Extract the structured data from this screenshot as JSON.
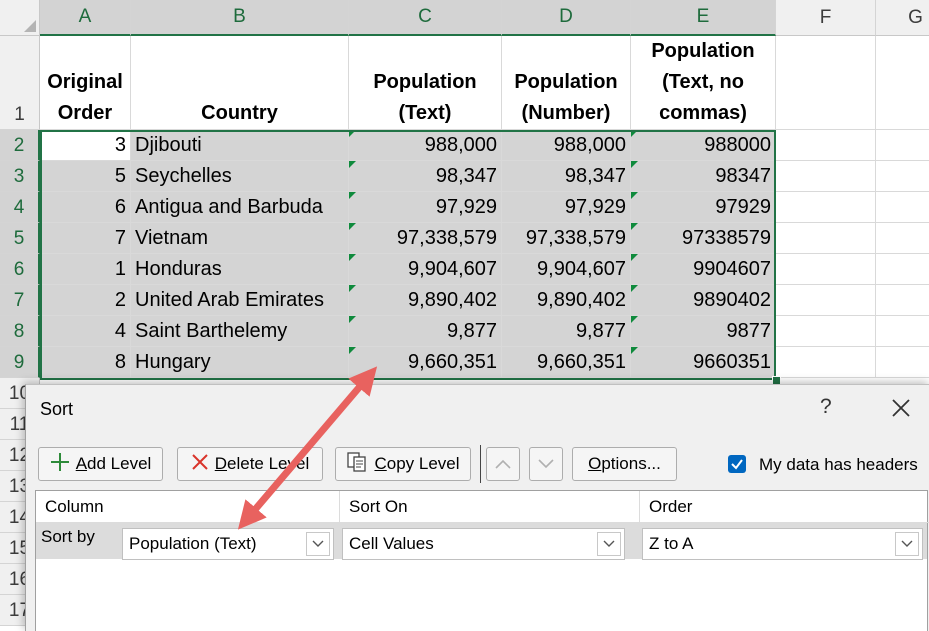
{
  "columns": [
    {
      "label": "A",
      "selected": true
    },
    {
      "label": "B",
      "selected": true
    },
    {
      "label": "C",
      "selected": true
    },
    {
      "label": "D",
      "selected": true
    },
    {
      "label": "E",
      "selected": true
    },
    {
      "label": "F",
      "selected": false
    },
    {
      "label": "G",
      "selected": false
    }
  ],
  "row_numbers": [
    "1",
    "2",
    "3",
    "4",
    "5",
    "6",
    "7",
    "8",
    "9",
    "10",
    "11",
    "12",
    "13",
    "14",
    "15",
    "16",
    "17"
  ],
  "headers": {
    "a": "Original\nOrder",
    "b": "Country",
    "c": "Population\n(Text)",
    "d": "Population\n(Number)",
    "e": "Population\n(Text, no\ncommas)"
  },
  "rows": [
    {
      "order": "3",
      "country": "Djibouti",
      "pop_text": "988,000",
      "pop_num": "988,000",
      "pop_nocomma": "988000"
    },
    {
      "order": "5",
      "country": "Seychelles",
      "pop_text": "98,347",
      "pop_num": "98,347",
      "pop_nocomma": "98347"
    },
    {
      "order": "6",
      "country": "Antigua and Barbuda",
      "pop_text": "97,929",
      "pop_num": "97,929",
      "pop_nocomma": "97929"
    },
    {
      "order": "7",
      "country": "Vietnam",
      "pop_text": "97,338,579",
      "pop_num": "97,338,579",
      "pop_nocomma": "97338579"
    },
    {
      "order": "1",
      "country": "Honduras",
      "pop_text": "9,904,607",
      "pop_num": "9,904,607",
      "pop_nocomma": "9904607"
    },
    {
      "order": "2",
      "country": "United Arab Emirates",
      "pop_text": "9,890,402",
      "pop_num": "9,890,402",
      "pop_nocomma": "9890402"
    },
    {
      "order": "4",
      "country": "Saint Barthelemy",
      "pop_text": "9,877",
      "pop_num": "9,877",
      "pop_nocomma": "9877"
    },
    {
      "order": "8",
      "country": "Hungary",
      "pop_text": "9,660,351",
      "pop_num": "9,660,351",
      "pop_nocomma": "9660351"
    }
  ],
  "colors": {
    "accent": "#217346",
    "selection_fill": "#d4d4d4",
    "text_flag": "#0f8a3c",
    "annotation_arrow": "#e8625f",
    "checkbox": "#0067c0"
  },
  "dialog": {
    "title": "Sort",
    "help": "?",
    "close_icon": "close-icon",
    "add_level": {
      "mnemonic": "A",
      "rest": "dd Level",
      "icon": "plus-icon"
    },
    "delete_level": {
      "mnemonic": "D",
      "rest": "elete Level",
      "icon": "x-icon"
    },
    "copy_level": {
      "mnemonic": "C",
      "rest": "opy Level",
      "icon": "copy-icon"
    },
    "move_up_icon": "chevron-up-icon",
    "move_down_icon": "chevron-down-icon",
    "options": {
      "mnemonic": "O",
      "rest": "ptions..."
    },
    "headers_checkbox": {
      "label": "My data has headers",
      "checked": true
    },
    "grid_headers": {
      "column": "Column",
      "sort_on": "Sort On",
      "order": "Order"
    },
    "sort_row": {
      "label": "Sort by",
      "column_value": "Population (Text)",
      "sort_on_value": "Cell Values",
      "order_value": "Z to A"
    }
  }
}
